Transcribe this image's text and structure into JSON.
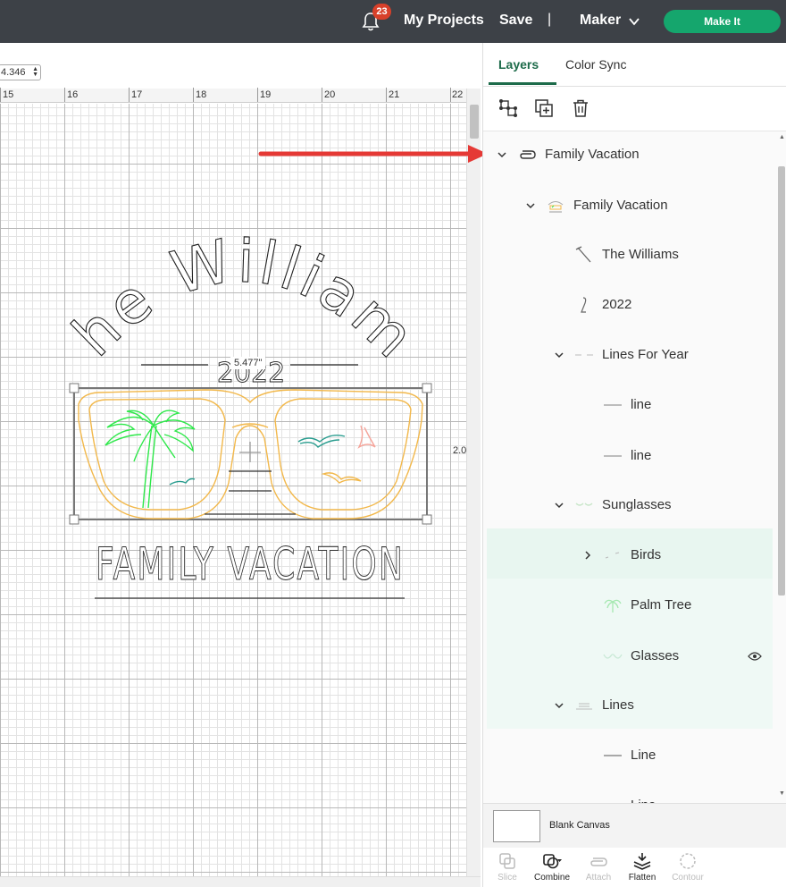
{
  "topbar": {
    "notification_count": "23",
    "my_projects": "My Projects",
    "save": "Save",
    "separator": "|",
    "machine": "Maker",
    "make_it": "Make It"
  },
  "toolbar": {
    "size_value": "4.346"
  },
  "ruler": {
    "marks": [
      "15",
      "16",
      "17",
      "18",
      "19",
      "20",
      "21",
      "22"
    ]
  },
  "canvas": {
    "text_top": "The Williams",
    "text_year": "2022",
    "text_bottom": "FAMILY VACATION",
    "width_label": "5.477\"",
    "height_label": "2.0"
  },
  "panel": {
    "tabs": [
      "Layers",
      "Color Sync"
    ],
    "tools": [
      "group-icon",
      "duplicate-icon",
      "trash-icon"
    ],
    "layers": [
      {
        "label": "Family Vacation",
        "level": 0,
        "expanded": true,
        "icon": "attach-icon"
      },
      {
        "label": "Family Vacation",
        "level": 1,
        "expanded": true,
        "icon": "design-thumb"
      },
      {
        "label": "The Williams",
        "level": 2,
        "icon": "text-thumb"
      },
      {
        "label": "2022",
        "level": 2,
        "icon": "text-thumb"
      },
      {
        "label": "Lines For Year",
        "level": 2,
        "expanded": true,
        "icon": "lines-thumb"
      },
      {
        "label": "line",
        "level": 3,
        "icon": "line-thumb"
      },
      {
        "label": "line",
        "level": 3,
        "icon": "line-thumb"
      },
      {
        "label": "Sunglasses",
        "level": 2,
        "expanded": true,
        "icon": "sunglasses-thumb"
      },
      {
        "label": "Birds",
        "level": 3,
        "expanded": false,
        "icon": "birds-thumb"
      },
      {
        "label": "Palm Tree",
        "level": 3,
        "icon": "palm-thumb"
      },
      {
        "label": "Glasses",
        "level": 3,
        "icon": "glasses-thumb"
      },
      {
        "label": "Lines",
        "level": 2,
        "expanded": true,
        "icon": "lines-thumb"
      },
      {
        "label": "Line",
        "level": 3,
        "icon": "line-thumb"
      },
      {
        "label": "Line",
        "level": 3,
        "icon": "line-thumb"
      }
    ],
    "canvas_label": "Blank Canvas",
    "actions": [
      "Slice",
      "Combine",
      "Attach",
      "Flatten",
      "Contour"
    ]
  },
  "colors": {
    "accent": "#15a66d",
    "tab_active": "#1d6b4a",
    "topbar": "#3d4147",
    "glasses_stroke": "#f2b84b",
    "palm": "#2ee84a",
    "bird_teal": "#2a9d8f",
    "bird_pink": "#f5a49a",
    "arrow": "#e53935"
  }
}
